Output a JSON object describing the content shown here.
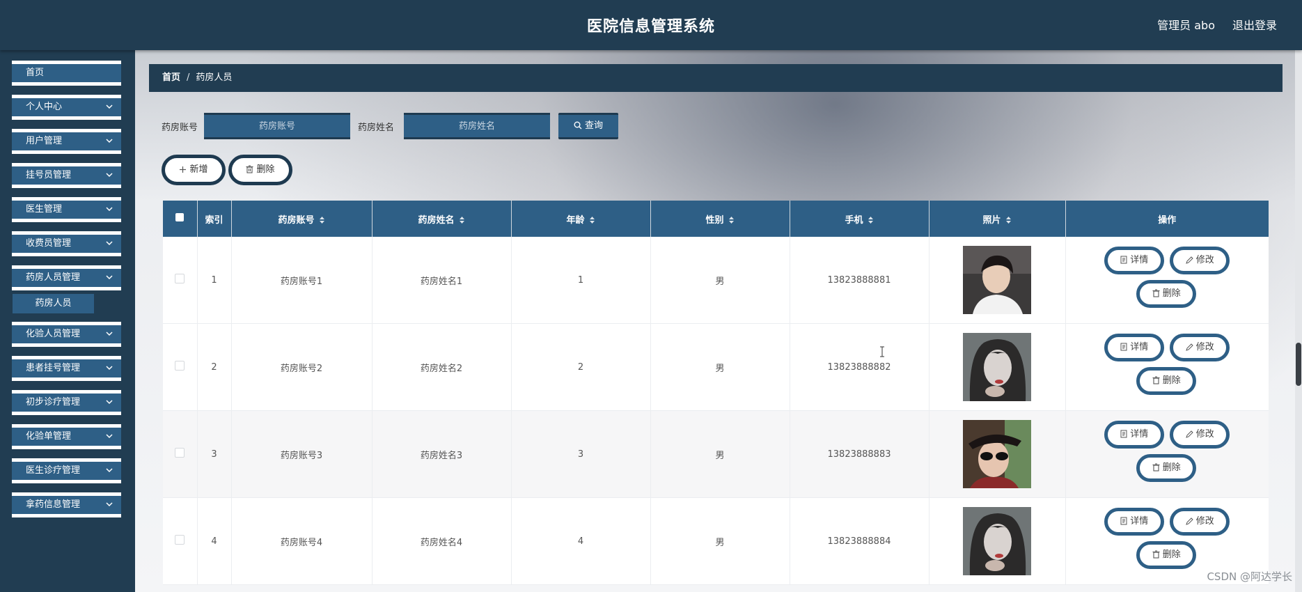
{
  "header": {
    "title": "医院信息管理系统",
    "user": "管理员 abo",
    "logout": "退出登录"
  },
  "sidebar": {
    "items": [
      {
        "label": "首页",
        "has_chevron": false
      },
      {
        "label": "个人中心",
        "has_chevron": true
      },
      {
        "label": "用户管理",
        "has_chevron": true
      },
      {
        "label": "挂号员管理",
        "has_chevron": true
      },
      {
        "label": "医生管理",
        "has_chevron": true
      },
      {
        "label": "收费员管理",
        "has_chevron": true
      },
      {
        "label": "药房人员管理",
        "has_chevron": true
      },
      {
        "label": "化验人员管理",
        "has_chevron": true
      },
      {
        "label": "患者挂号管理",
        "has_chevron": true
      },
      {
        "label": "初步诊疗管理",
        "has_chevron": true
      },
      {
        "label": "化验单管理",
        "has_chevron": true
      },
      {
        "label": "医生诊疗管理",
        "has_chevron": true
      },
      {
        "label": "拿药信息管理",
        "has_chevron": true
      }
    ],
    "subitem": "药房人员"
  },
  "breadcrumb": {
    "home": "首页",
    "separator": "/",
    "current": "药房人员"
  },
  "search": {
    "account_label": "药房账号",
    "account_placeholder": "药房账号",
    "name_label": "药房姓名",
    "name_placeholder": "药房姓名",
    "query_label": "查询"
  },
  "actions": {
    "add_label": "新增",
    "delete_label": "删除"
  },
  "table": {
    "columns": [
      "索引",
      "药房账号",
      "药房姓名",
      "年龄",
      "性别",
      "手机",
      "照片",
      "操作"
    ],
    "rows": [
      {
        "index": "1",
        "account": "药房账号1",
        "name": "药房姓名1",
        "age": "1",
        "gender": "男",
        "phone": "13823888881"
      },
      {
        "index": "2",
        "account": "药房账号2",
        "name": "药房姓名2",
        "age": "2",
        "gender": "男",
        "phone": "13823888882"
      },
      {
        "index": "3",
        "account": "药房账号3",
        "name": "药房姓名3",
        "age": "3",
        "gender": "男",
        "phone": "13823888883"
      },
      {
        "index": "4",
        "account": "药房账号4",
        "name": "药房姓名4",
        "age": "4",
        "gender": "男",
        "phone": "13823888884"
      }
    ],
    "op_detail": "详情",
    "op_edit": "修改",
    "op_delete": "删除"
  },
  "watermark": "CSDN @阿达学长",
  "colors": {
    "header_bg": "#213d52",
    "menu_bg": "#2e5f86",
    "table_header": "#2e5f86"
  }
}
